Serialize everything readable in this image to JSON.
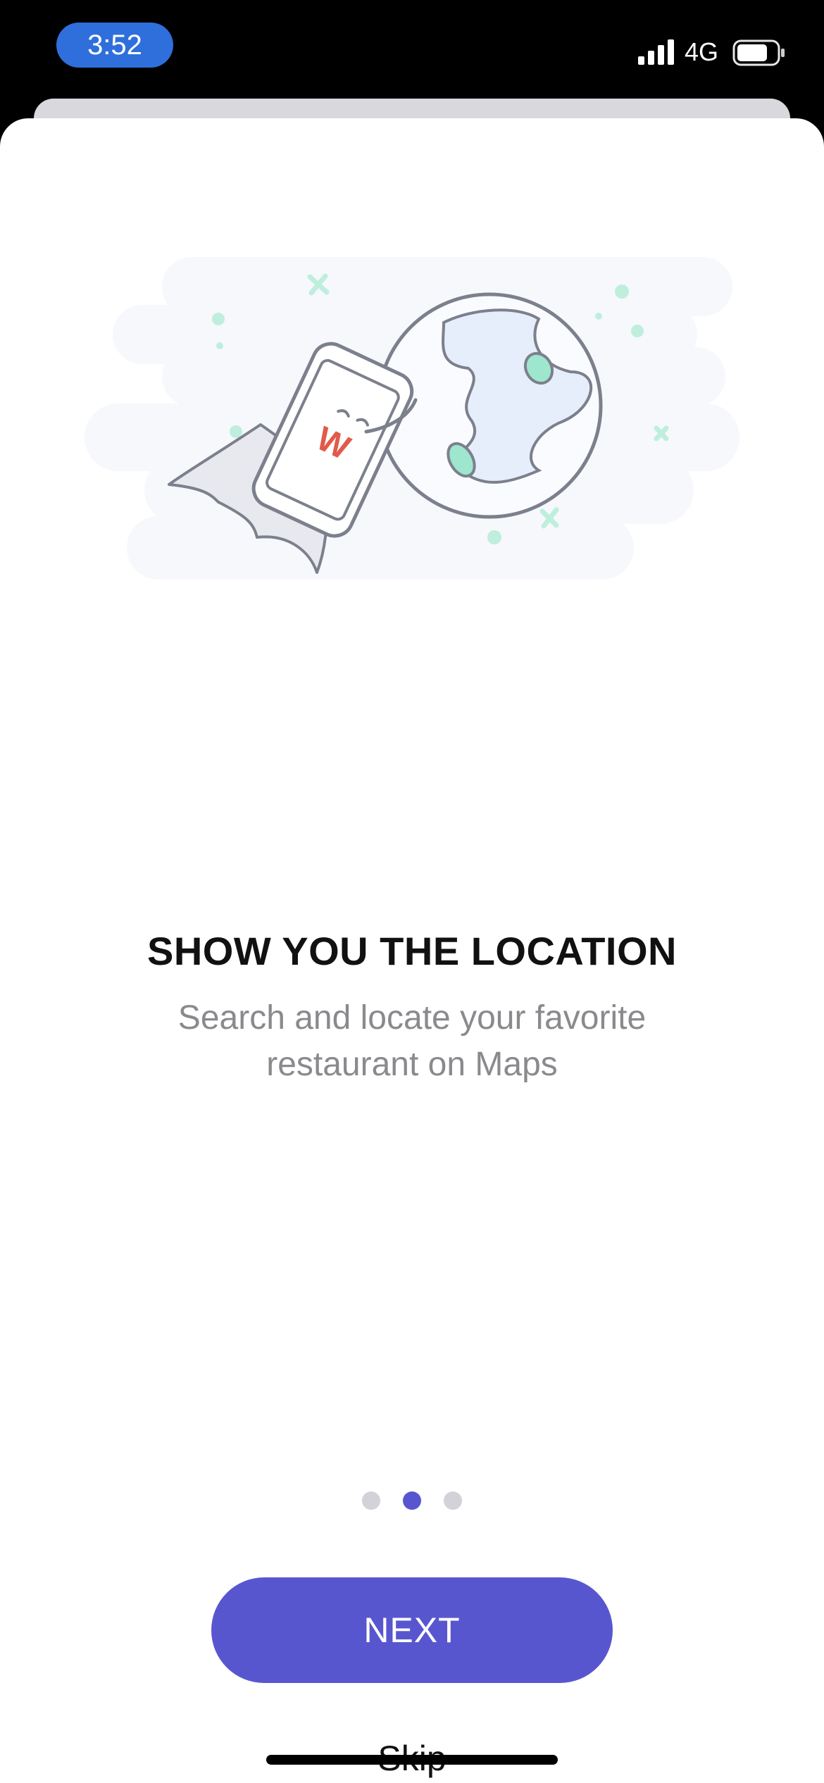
{
  "status_bar": {
    "time": "3:52",
    "network": "4G",
    "icons": [
      "signal-bars-icon",
      "battery-icon"
    ]
  },
  "colors": {
    "accent": "#5856cf",
    "time_pill": "#2f6fdc",
    "illustration_green": "#8fe0c6"
  },
  "onboarding": {
    "title": "SHOW YOU THE LOCATION",
    "subtitle": "Search and locate your favorite restaurant on Maps",
    "page_count": 3,
    "active_page": 2,
    "illustration_icon": "phone-superhero-globe-illustration",
    "phone_logo": "W"
  },
  "actions": {
    "next_label": "NEXT",
    "skip_label": "Skip"
  }
}
